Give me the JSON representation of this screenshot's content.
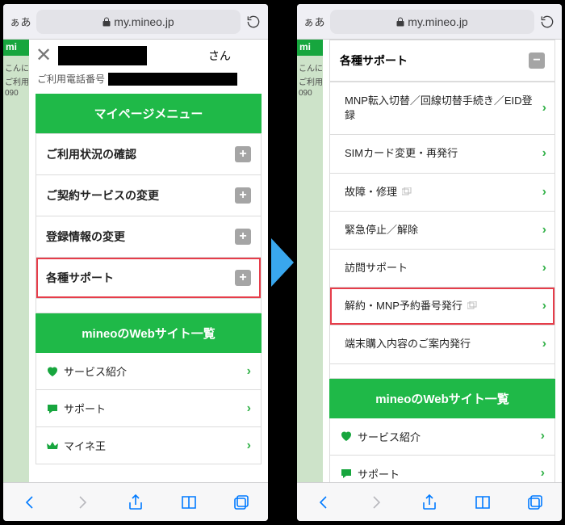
{
  "browser": {
    "aa": "ぁあ",
    "url": "my.mineo.jp"
  },
  "left": {
    "overlay": {
      "line1": "こんに",
      "line2": "ご利用",
      "line3": "090"
    },
    "user_suffix": "さん",
    "tel_label": "ご利用電話番号",
    "header": "マイページメニュー",
    "items": [
      {
        "label": "ご利用状況の確認",
        "highlight": false
      },
      {
        "label": "ご契約サービスの変更",
        "highlight": false
      },
      {
        "label": "登録情報の変更",
        "highlight": false
      },
      {
        "label": "各種サポート",
        "highlight": true
      }
    ],
    "web_header": "mineoのWebサイト一覧",
    "links": [
      {
        "icon": "heart",
        "label": "サービス紹介"
      },
      {
        "icon": "chat",
        "label": "サポート"
      },
      {
        "icon": "crown",
        "label": "マイネ王"
      }
    ]
  },
  "right": {
    "overlay": {
      "line1": "こんに",
      "line2": "ご利用",
      "line3": "090"
    },
    "top_label": "各種サポート",
    "items": [
      {
        "label": "MNP転入切替／回線切替手続き／EID登録",
        "ext": false,
        "highlight": false
      },
      {
        "label": "SIMカード変更・再発行",
        "ext": false,
        "highlight": false
      },
      {
        "label": "故障・修理",
        "ext": true,
        "highlight": false
      },
      {
        "label": "緊急停止／解除",
        "ext": false,
        "highlight": false
      },
      {
        "label": "訪問サポート",
        "ext": false,
        "highlight": false
      },
      {
        "label": "解約・MNP予約番号発行",
        "ext": true,
        "highlight": true
      },
      {
        "label": "端末購入内容のご案内発行",
        "ext": false,
        "highlight": false
      }
    ],
    "web_header": "mineoのWebサイト一覧",
    "links": [
      {
        "icon": "heart",
        "label": "サービス紹介"
      },
      {
        "icon": "chat",
        "label": "サポート"
      }
    ]
  }
}
